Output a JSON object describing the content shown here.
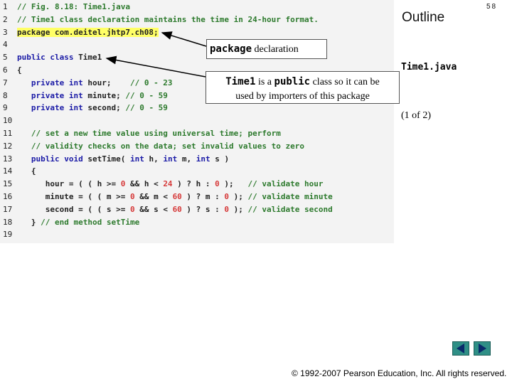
{
  "slide": {
    "number": "58",
    "outline_label": "Outline",
    "file_title": "Time1.java",
    "page_indicator": "(1 of 2)",
    "copyright": "© 1992-2007 Pearson Education, Inc.  All rights reserved."
  },
  "callouts": {
    "package": {
      "code": "package",
      "text": " declaration"
    },
    "class": {
      "code_a": "Time1",
      "text_a": " is a ",
      "code_b": "public",
      "text_b": " class so it can be",
      "line2": "used by importers of this package"
    }
  },
  "code": {
    "lines": [
      {
        "n": "1",
        "parts": [
          {
            "t": "cm",
            "v": "// Fig. 8.18: Time1.java"
          }
        ]
      },
      {
        "n": "2",
        "parts": [
          {
            "t": "cm",
            "v": "// Time1 class declaration maintains the time in 24-hour format."
          }
        ]
      },
      {
        "n": "3",
        "parts": [
          {
            "t": "hl",
            "v": "package com.deitel.jhtp7.ch08;"
          }
        ]
      },
      {
        "n": "4",
        "parts": []
      },
      {
        "n": "5",
        "parts": [
          {
            "t": "kw",
            "v": "public class "
          },
          {
            "t": "id",
            "v": "Time1"
          }
        ]
      },
      {
        "n": "6",
        "parts": [
          {
            "t": "id",
            "v": "{"
          }
        ]
      },
      {
        "n": "7",
        "parts": [
          {
            "t": "kw",
            "v": "   private int "
          },
          {
            "t": "id",
            "v": "hour;    "
          },
          {
            "t": "cm",
            "v": "// 0 - 23"
          }
        ]
      },
      {
        "n": "8",
        "parts": [
          {
            "t": "kw",
            "v": "   private int "
          },
          {
            "t": "id",
            "v": "minute; "
          },
          {
            "t": "cm",
            "v": "// 0 - 59"
          }
        ]
      },
      {
        "n": "9",
        "parts": [
          {
            "t": "kw",
            "v": "   private int "
          },
          {
            "t": "id",
            "v": "second; "
          },
          {
            "t": "cm",
            "v": "// 0 - 59"
          }
        ]
      },
      {
        "n": "10",
        "parts": []
      },
      {
        "n": "11",
        "parts": [
          {
            "t": "cm",
            "v": "   // set a new time value using universal time; perform"
          }
        ]
      },
      {
        "n": "12",
        "parts": [
          {
            "t": "cm",
            "v": "   // validity checks on the data; set invalid values to zero"
          }
        ]
      },
      {
        "n": "13",
        "parts": [
          {
            "t": "kw",
            "v": "   public void "
          },
          {
            "t": "id",
            "v": "setTime( "
          },
          {
            "t": "kw",
            "v": "int "
          },
          {
            "t": "id",
            "v": "h, "
          },
          {
            "t": "kw",
            "v": "int "
          },
          {
            "t": "id",
            "v": "m, "
          },
          {
            "t": "kw",
            "v": "int "
          },
          {
            "t": "id",
            "v": "s )"
          }
        ]
      },
      {
        "n": "14",
        "parts": [
          {
            "t": "id",
            "v": "   {"
          }
        ]
      },
      {
        "n": "15",
        "parts": [
          {
            "t": "id",
            "v": "      hour = ( ( h >= "
          },
          {
            "t": "num",
            "v": "0"
          },
          {
            "t": "id",
            "v": " && h < "
          },
          {
            "t": "num",
            "v": "24"
          },
          {
            "t": "id",
            "v": " ) ? h : "
          },
          {
            "t": "num",
            "v": "0"
          },
          {
            "t": "id",
            "v": " );   "
          },
          {
            "t": "cm",
            "v": "// validate hour"
          }
        ]
      },
      {
        "n": "16",
        "parts": [
          {
            "t": "id",
            "v": "      minute = ( ( m >= "
          },
          {
            "t": "num",
            "v": "0"
          },
          {
            "t": "id",
            "v": " && m < "
          },
          {
            "t": "num",
            "v": "60"
          },
          {
            "t": "id",
            "v": " ) ? m : "
          },
          {
            "t": "num",
            "v": "0"
          },
          {
            "t": "id",
            "v": " ); "
          },
          {
            "t": "cm",
            "v": "// validate minute"
          }
        ]
      },
      {
        "n": "17",
        "parts": [
          {
            "t": "id",
            "v": "      second = ( ( s >= "
          },
          {
            "t": "num",
            "v": "0"
          },
          {
            "t": "id",
            "v": " && s < "
          },
          {
            "t": "num",
            "v": "60"
          },
          {
            "t": "id",
            "v": " ) ? s : "
          },
          {
            "t": "num",
            "v": "0"
          },
          {
            "t": "id",
            "v": " ); "
          },
          {
            "t": "cm",
            "v": "// validate second"
          }
        ]
      },
      {
        "n": "18",
        "parts": [
          {
            "t": "id",
            "v": "   } "
          },
          {
            "t": "cm",
            "v": "// end method setTime"
          }
        ]
      },
      {
        "n": "19",
        "parts": []
      }
    ]
  },
  "nav": {
    "prev_icon": "triangle-left-icon",
    "next_icon": "triangle-right-icon",
    "button_color": "#2f8f86"
  }
}
